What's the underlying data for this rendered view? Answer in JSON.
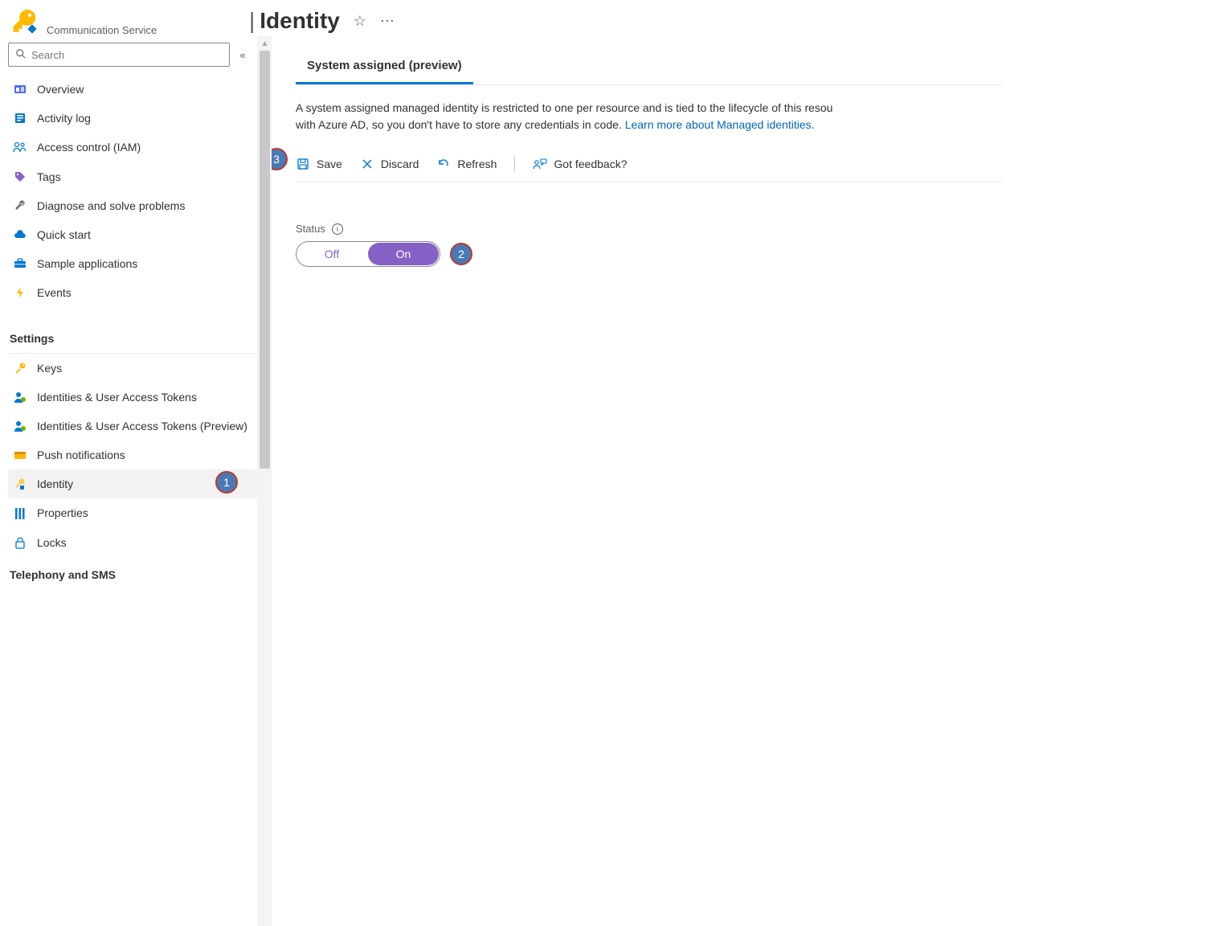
{
  "header": {
    "service_type": "Communication Service",
    "title": "Identity"
  },
  "search": {
    "placeholder": "Search"
  },
  "sidebar": {
    "items_top": [
      {
        "label": "Overview"
      },
      {
        "label": "Activity log"
      },
      {
        "label": "Access control (IAM)"
      },
      {
        "label": "Tags"
      },
      {
        "label": "Diagnose and solve problems"
      },
      {
        "label": "Quick start"
      },
      {
        "label": "Sample applications"
      },
      {
        "label": "Events"
      }
    ],
    "section_settings": "Settings",
    "items_settings": [
      {
        "label": "Keys"
      },
      {
        "label": "Identities & User Access Tokens"
      },
      {
        "label": "Identities & User Access Tokens (Preview)"
      },
      {
        "label": "Push notifications"
      },
      {
        "label": "Identity"
      },
      {
        "label": "Properties"
      },
      {
        "label": "Locks"
      }
    ],
    "section_telephony": "Telephony and SMS"
  },
  "main": {
    "tab_label": "System assigned (preview)",
    "description_part1": "A system assigned managed identity is restricted to one per resource and is tied to the lifecycle of this resou",
    "description_part2": "with Azure AD, so you don't have to store any credentials in code. ",
    "learn_more": "Learn more about Managed identities.",
    "toolbar": {
      "save": "Save",
      "discard": "Discard",
      "refresh": "Refresh",
      "feedback": "Got feedback?"
    },
    "status_label": "Status",
    "toggle": {
      "off": "Off",
      "on": "On",
      "value": "On"
    }
  },
  "callouts": {
    "step1": "1",
    "step2": "2",
    "step3": "3"
  }
}
